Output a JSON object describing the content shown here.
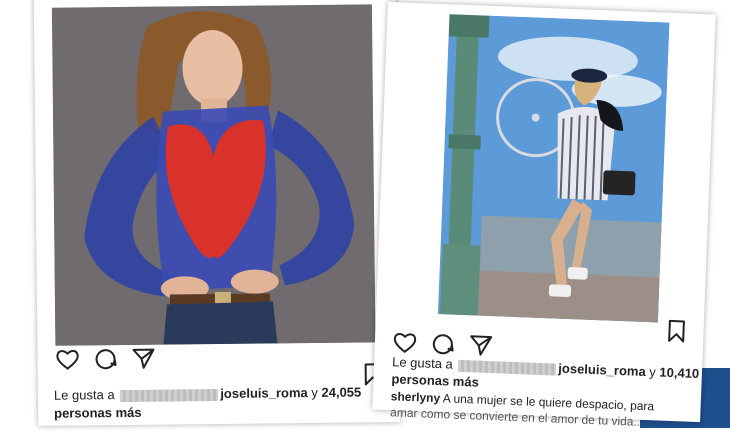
{
  "posts": [
    {
      "likes_prefix": "Le gusta a",
      "liker": "joseluis_roma",
      "likes_joiner": "y",
      "likes_count": "24,055",
      "likes_suffix": "personas más"
    },
    {
      "likes_prefix": "Le gusta a",
      "liker": "joseluis_roma",
      "likes_joiner": "y",
      "likes_count": "10,410",
      "likes_suffix": "personas más",
      "caption_user": "sherlyny",
      "caption_text": "A una mujer se le quiere despacio, para",
      "caption_text_2": "amar como se convierte en el amor de tu vida..."
    }
  ],
  "icons": [
    "heart-icon",
    "comment-icon",
    "share-icon",
    "bookmark-icon"
  ],
  "colors": {
    "accent_blue": "#1f4e8c",
    "dress_red": "#d8322a",
    "mesh_blue": "#2b3fa8"
  }
}
